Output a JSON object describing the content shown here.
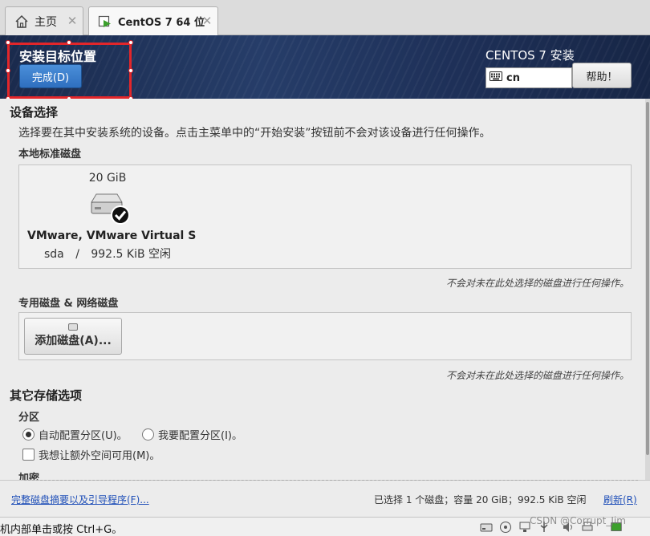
{
  "tabs": [
    {
      "label": "主页",
      "icon": "home-icon"
    },
    {
      "label": "CentOS 7 64 位",
      "icon": "vm-icon"
    }
  ],
  "header": {
    "title": "安装目标位置",
    "done_label": "完成(D)",
    "product": "CENTOS 7 安装",
    "keyboard_layout": "cn",
    "help_label": "帮助！"
  },
  "device_selection": {
    "title": "设备选择",
    "description": "选择要在其中安装系统的设备。点击主菜单中的“开始安装”按钮前不会对该设备进行任何操作。",
    "local_disks_label": "本地标准磁盘",
    "disk": {
      "size": "20 GiB",
      "name": "VMware, VMware Virtual S",
      "device": "sda",
      "separator": "/",
      "free": "992.5 KiB 空闲",
      "selected": true
    },
    "local_note": "不会对未在此处选择的磁盘进行任何操作。",
    "special_disks_label": "专用磁盘 & 网络磁盘",
    "add_disk_label": "添加磁盘(A)...",
    "special_note": "不会对未在此处选择的磁盘进行任何操作。"
  },
  "other_storage": {
    "title": "其它存储选项",
    "partitioning_label": "分区",
    "auto_label": "自动配置分区(U)。",
    "manual_label": "我要配置分区(I)。",
    "auto_selected": true,
    "extra_space_label": "我想让额外空间可用(M)。",
    "encryption_label": "加密"
  },
  "footer": {
    "summary_link": "完整磁盘摘要以及引导程序(F)...",
    "summary": "已选择 1 个磁盘；容量 20 GiB；992.5 KiB 空闲",
    "refresh_label": "刷新(R)"
  },
  "statusbar": {
    "text": "机内部单击或按 Ctrl+G。",
    "watermark": "CSDN @Corrupt_Jim"
  },
  "colors": {
    "header_bg": "#1e3058",
    "done_button": "#3a7fcd",
    "selection_outline": "#e3262a",
    "link": "#1f4fb8"
  }
}
